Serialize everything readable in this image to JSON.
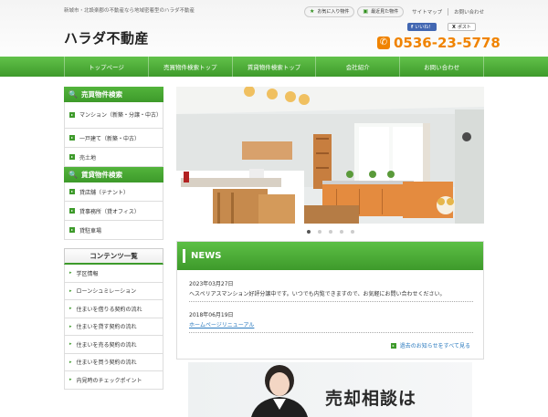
{
  "header": {
    "tagline": "新城市・北設楽郡の不動産なら地域密着型のハラダ不動産",
    "logo": "ハラダ不動産",
    "favorites_label": "お気に入り物件",
    "recent_label": "最近見た物件",
    "sitemap_label": "サイトマップ",
    "contact_link_label": "お問い合わせ",
    "fb_label": "いいね！",
    "tw_label": "ポスト",
    "phone": "0536-23-5778"
  },
  "nav": {
    "items": [
      "トップページ",
      "売買物件検索トップ",
      "賃貸物件検索トップ",
      "会社紹介",
      "お問い合わせ"
    ]
  },
  "sidebar": {
    "sale_title": "売買物件検索",
    "sale_items": [
      "マンション（新築・分譲・中古）",
      "一戸建て（新築・中古）",
      "売土地"
    ],
    "rent_title": "賃貸物件検索",
    "rent_items": [
      "貸店舗（テナント）",
      "貸事務所（貸オフィス）",
      "貸駐車場"
    ],
    "contents_title": "コンテンツ一覧",
    "contents_items": [
      "学区情報",
      "ローンシュミレーション",
      "住まいを借りる契約の流れ",
      "住まいを貸す契約の流れ",
      "住まいを売る契約の流れ",
      "住まいを買う契約の流れ",
      "内見時のチェックポイント"
    ]
  },
  "news": {
    "title": "NEWS",
    "entries": [
      {
        "date": "2023年03月27日",
        "text": "ヘスペリアスマンション好評分譲中です。いつでも内覧できますので、お気軽にお問い合わせください。"
      },
      {
        "date": "2018年06月19日",
        "text": "ホームページリニューアル"
      }
    ],
    "more_label": "過去のお知らせをすべて見る"
  },
  "slider": {
    "dot_count": 5,
    "active": 0
  },
  "banner": {
    "text": "売却相談は"
  },
  "colors": {
    "brand_green": "#3d9a2a",
    "phone_orange": "#f08300",
    "link_blue": "#2a7abf"
  },
  "icons": {
    "search": "search-icon",
    "star": "star-icon",
    "phone": "phone-icon",
    "arrow": "arrow-right-icon"
  }
}
